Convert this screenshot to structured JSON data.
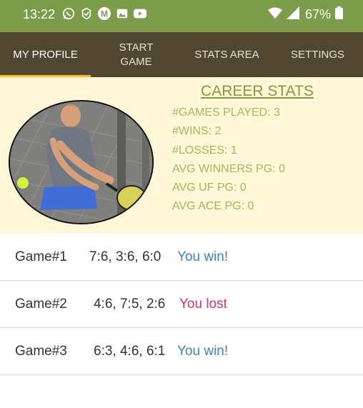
{
  "status_bar": {
    "time": "13:22",
    "battery": "67%",
    "notification_icons": [
      "whatsapp-icon",
      "check-badge-icon",
      "m-icon",
      "image-icon",
      "youtube-icon"
    ]
  },
  "tabs": [
    {
      "label": "MY PROFILE",
      "active": true
    },
    {
      "label": "START GAME",
      "active": false
    },
    {
      "label": "STATS AREA",
      "active": false
    },
    {
      "label": "SETTINGS",
      "active": false
    }
  ],
  "career_stats": {
    "title": "CAREER STATS",
    "lines": [
      {
        "label": "#GAMES PLAYED:",
        "value": "3"
      },
      {
        "label": "#WINS:",
        "value": "2"
      },
      {
        "label": "#LOSSES:",
        "value": "1"
      },
      {
        "label": "AVG WINNERS PG:",
        "value": "0"
      },
      {
        "label": "AVG UF PG:",
        "value": "0"
      },
      {
        "label": "AVG ACE PG:",
        "value": "0"
      }
    ]
  },
  "games": [
    {
      "name": "Game#1",
      "score": "7:6, 3:6, 6:0",
      "result": "You win!"
    },
    {
      "name": "Game#2",
      "score": "4:6, 7:5, 2:6",
      "result": "You lost"
    },
    {
      "name": "Game#3",
      "score": "6:3, 4:6, 6:1",
      "result": "You win!"
    }
  ],
  "colors": {
    "status_bar": "#7b9c48",
    "tab_bar": "#514630",
    "tab_indicator": "#f5c518",
    "profile_bg": "#fff7d8",
    "stats_title": "#7d9d3c",
    "stats_text": "#9dbd57",
    "win": "#3b82c4",
    "loss": "#d6336c"
  }
}
